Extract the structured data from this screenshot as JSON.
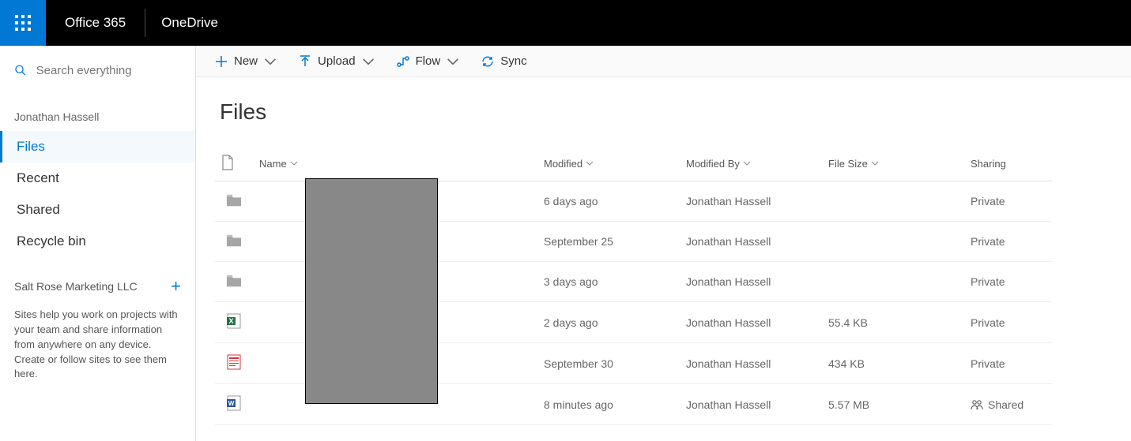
{
  "header": {
    "brand": "Office 365",
    "app": "OneDrive"
  },
  "search": {
    "placeholder": "Search everything"
  },
  "sidebar": {
    "owner": "Jonathan Hassell",
    "nav": [
      {
        "label": "Files",
        "active": true
      },
      {
        "label": "Recent",
        "active": false
      },
      {
        "label": "Shared",
        "active": false
      },
      {
        "label": "Recycle bin",
        "active": false
      }
    ],
    "org": "Salt Rose Marketing LLC",
    "help": "Sites help you work on projects with your team and share information from anywhere on any device. Create or follow sites to see them here."
  },
  "toolbar": {
    "new_label": "New",
    "upload_label": "Upload",
    "flow_label": "Flow",
    "sync_label": "Sync"
  },
  "page": {
    "title": "Files"
  },
  "columns": {
    "name": "Name",
    "modified": "Modified",
    "modified_by": "Modified By",
    "file_size": "File Size",
    "sharing": "Sharing"
  },
  "rows": [
    {
      "type": "folder",
      "modified": "6 days ago",
      "modified_by": "Jonathan Hassell",
      "size": "",
      "sharing": "Private"
    },
    {
      "type": "folder",
      "modified": "September 25",
      "modified_by": "Jonathan Hassell",
      "size": "",
      "sharing": "Private"
    },
    {
      "type": "folder",
      "modified": "3 days ago",
      "modified_by": "Jonathan Hassell",
      "size": "",
      "sharing": "Private"
    },
    {
      "type": "excel",
      "modified": "2 days ago",
      "modified_by": "Jonathan Hassell",
      "size": "55.4 KB",
      "sharing": "Private"
    },
    {
      "type": "pdf",
      "modified": "September 30",
      "modified_by": "Jonathan Hassell",
      "size": "434 KB",
      "sharing": "Private"
    },
    {
      "type": "word",
      "modified": "8 minutes ago",
      "modified_by": "Jonathan Hassell",
      "size": "5.57 MB",
      "sharing": "Shared"
    }
  ]
}
